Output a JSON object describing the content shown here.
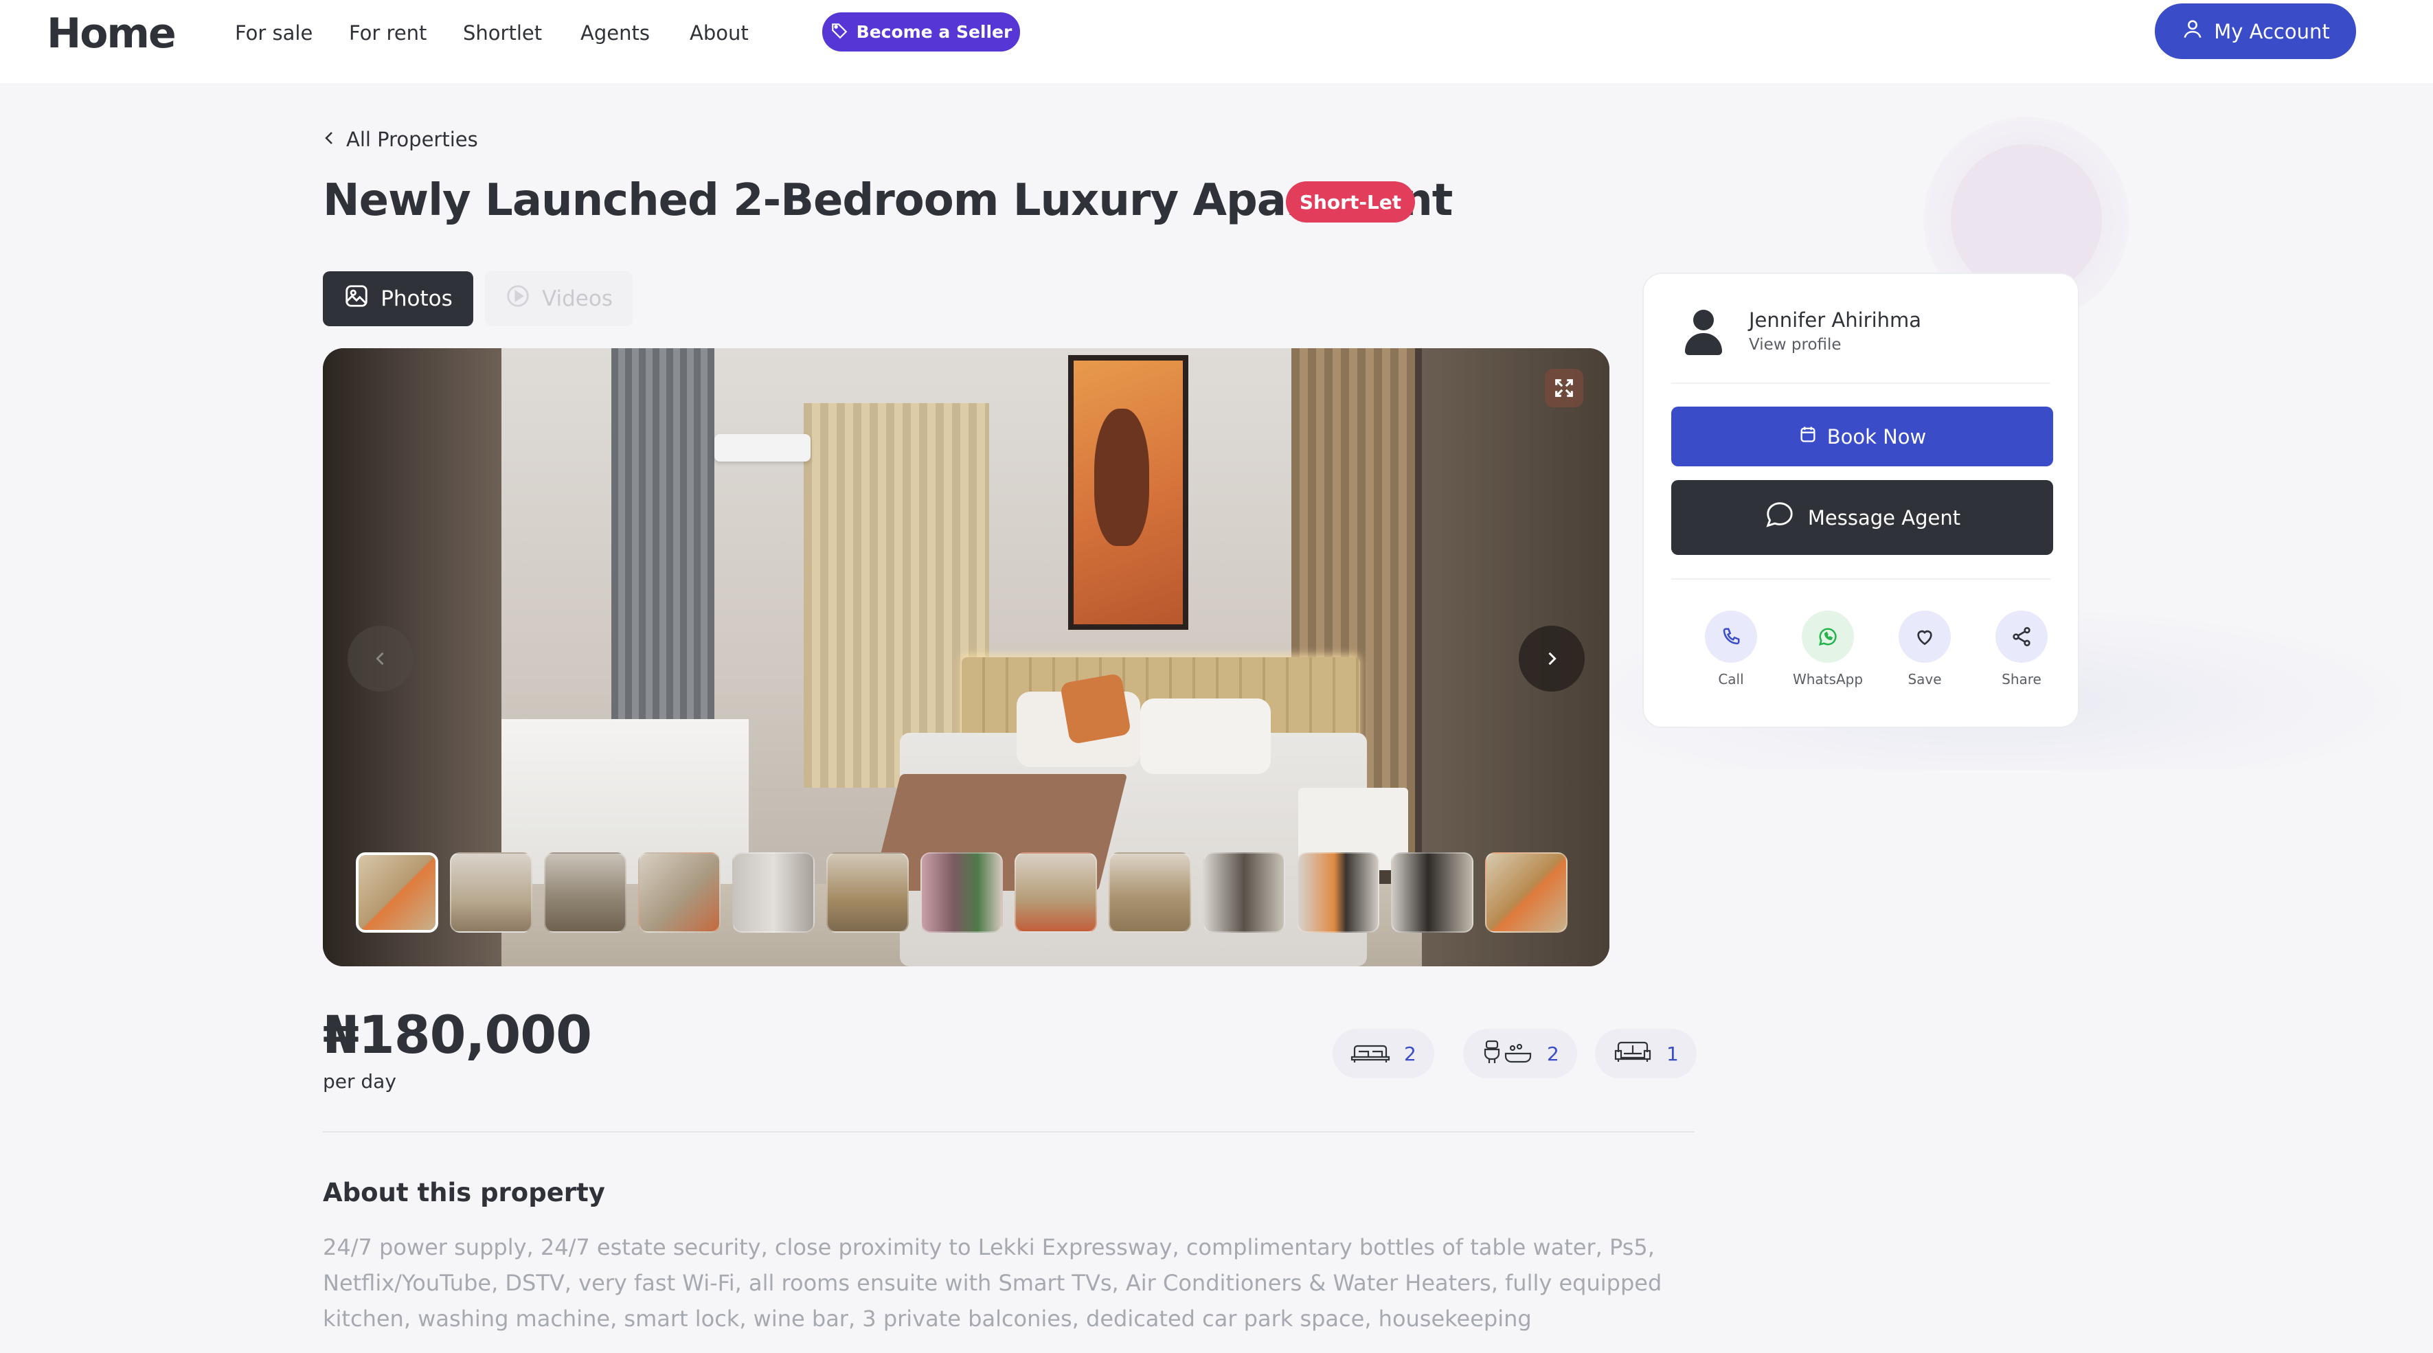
{
  "nav": {
    "logo": "Home",
    "links": [
      "For sale",
      "For rent",
      "Shortlet",
      "Agents",
      "About"
    ],
    "seller_button": "Become a Seller",
    "account_button": "My Account"
  },
  "header": {
    "back_label": "All Properties",
    "title": "Newly Launched 2-Bedroom Luxury Apartment",
    "badge": "Short-Let"
  },
  "media_tabs": {
    "photos": "Photos",
    "videos": "Videos",
    "active": "Photos"
  },
  "gallery": {
    "thumbnail_count": 13,
    "active_index": 0,
    "icons": {
      "expand": "expand-icon",
      "prev": "chevron-left-icon",
      "next": "chevron-right-icon"
    }
  },
  "agent": {
    "name": "Jennifer Ahirihma",
    "profile_link": "View profile",
    "book_button": "Book Now",
    "message_button": "Message Agent",
    "actions": [
      {
        "label": "Call",
        "icon": "phone-icon",
        "color": "#3a4cc8"
      },
      {
        "label": "WhatsApp",
        "icon": "whatsapp-icon",
        "color": "#25b34b"
      },
      {
        "label": "Save",
        "icon": "heart-icon",
        "color": "#2f3238"
      },
      {
        "label": "Share",
        "icon": "share-icon",
        "color": "#2f3238"
      }
    ]
  },
  "listing": {
    "price": "₦180,000",
    "period": "per day",
    "specs": [
      {
        "icon": "bed-icon",
        "value": "2"
      },
      {
        "icon": "bath-icon",
        "value": "2"
      },
      {
        "icon": "sofa-icon",
        "value": "1"
      }
    ]
  },
  "about": {
    "heading": "About this property",
    "text": "24/7 power supply, 24/7 estate security, close proximity to Lekki Expressway, complimentary bottles of table water, Ps5, Netflix/YouTube, DSTV, very fast Wi-Fi, all rooms ensuite with Smart TVs, Air Conditioners & Water Heaters, fully equipped kitchen, washing machine, smart lock, wine bar, 3 private balconies, dedicated car park space, housekeeping"
  },
  "colors": {
    "accent_blue": "#3a4cc8",
    "seller_purple": "#5637d6",
    "badge_red": "#e23e5c",
    "dark": "#2f3238"
  }
}
